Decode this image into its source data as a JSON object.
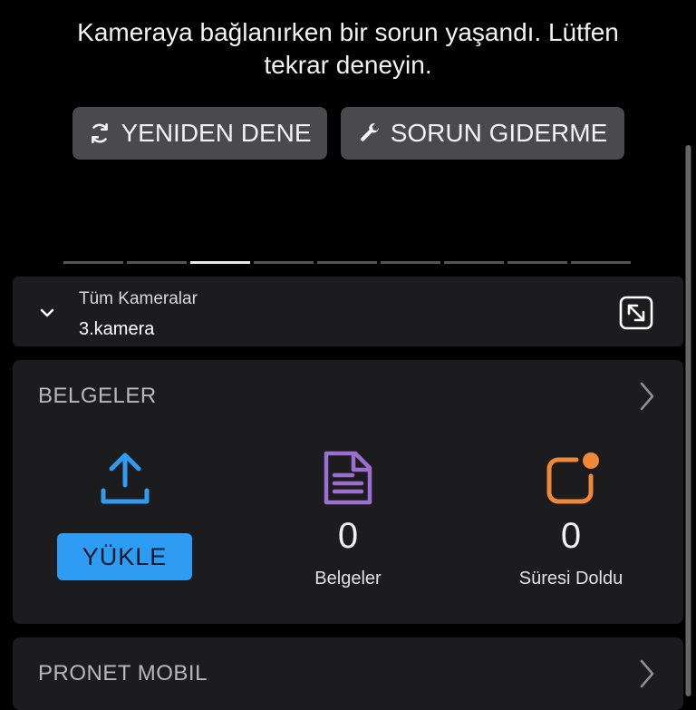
{
  "error": {
    "line1": "Kameraya bağlanırken bir sorun yaşandı. Lütfen",
    "line2": "tekrar deneyin."
  },
  "actions": {
    "retry_label": "YENIDEN DENE",
    "troubleshoot_label": "SORUN GIDERME"
  },
  "pager": {
    "count": 9,
    "active_index": 2
  },
  "camera": {
    "group_label": "Tüm Kameralar",
    "selected": "3.kamera"
  },
  "documents": {
    "title": "BELGELER",
    "upload_label": "YÜKLE",
    "documents_count": "0",
    "documents_label": "Belgeler",
    "expired_count": "0",
    "expired_label": "Süresi Doldu"
  },
  "pronet": {
    "title": "PRONET MOBIL"
  },
  "colors": {
    "background": "#000000",
    "card": "#1c1c1e",
    "button": "#4a4a4d",
    "upload_blue": "#2e9cf2",
    "document_purple": "#9b6fd1",
    "expired_orange": "#f0883a"
  },
  "icons": [
    "retry-icon",
    "wrench-icon",
    "chevron-down-icon",
    "expand-icon",
    "chevron-right-icon",
    "upload-icon",
    "document-icon",
    "expired-icon"
  ]
}
